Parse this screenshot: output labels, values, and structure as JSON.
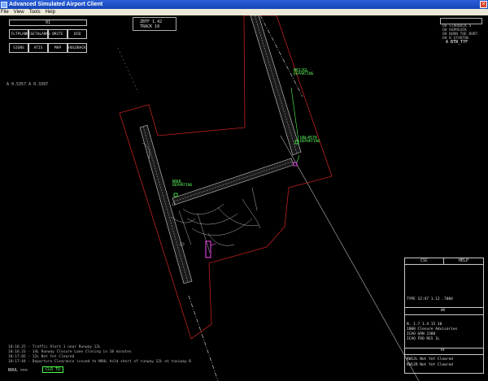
{
  "window": {
    "title": "Advanced Simulated Airport Client"
  },
  "menu": [
    "File",
    "View",
    "Tools",
    "Help"
  ],
  "top_panel": {
    "field": "01",
    "buttons": [
      [
        "FLTPLAN",
        "RESETALARMS",
        "BRITE",
        "DCB"
      ],
      [
        "SIGNS",
        "ATIS",
        "MAP",
        "HOLDBACK"
      ]
    ]
  },
  "scope_info": [
    "ZBTF 1.42",
    "TRACK 10"
  ],
  "range_readout": "A 0.5357 A 0.3397",
  "right_list": {
    "lines": [
      "OH STARBUCK 4",
      "OH HSPROJEK",
      "OH BURN THE BORT",
      "OH B STARTNG"
    ],
    "active": "A BTN_TYF"
  },
  "tags": [
    {
      "callsign": "N612GL",
      "detail": "DEPARTING"
    },
    {
      "callsign": "UAL4576",
      "detail": "DEPARTING"
    },
    {
      "callsign": "N9UL",
      "detail": "DEPARTING"
    }
  ],
  "status_panel": {
    "headers": [
      "CSC",
      "HELP"
    ],
    "time_line": "TYPE 12:47 1.12 .7004",
    "section1_title": "WX",
    "section1_lines": [
      "N. 1.7 1.4 15 10",
      "1008 Closure Advisories",
      "ICAO GRN 2300",
      "ICAO FRO RES 1L"
    ],
    "section2_title": "RF",
    "section2_lines": [
      "RW12L Not Yet Cleared",
      "RW12R Not Yet Cleared"
    ]
  },
  "messages": [
    "10:16:25 - Traffic Alert 1 near Runway 12L",
    "10:16:33 - 14L Runway Closure Lane Closing in 18 minutes",
    "10:17:05 - 12L Not Yet Cleared",
    "10:17:44 - Departure Clearance issued to N9UL hold short of runway 12L at taxiway B"
  ],
  "command": {
    "prompt": "N9UL >>>",
    "value": "CLR TO"
  },
  "colors": {
    "boundary": "#c02020",
    "runway": "#d0d0d0",
    "tag": "#4cff4c",
    "vehicle": "#e040e0",
    "airspace_line": "#b0b0b0"
  }
}
